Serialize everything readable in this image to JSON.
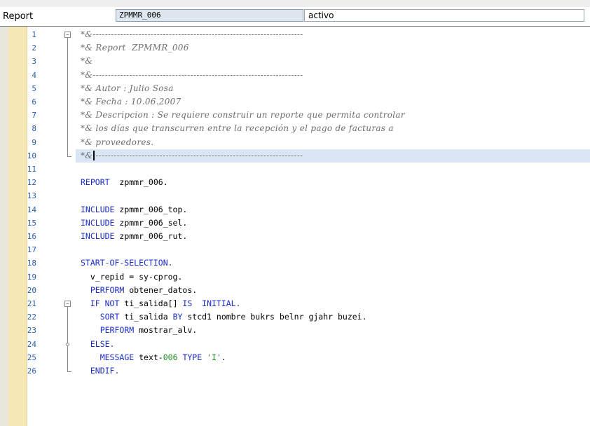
{
  "header": {
    "label": "Report",
    "program_name": "ZPMMR_006",
    "status": "activo"
  },
  "editor": {
    "line_numbers": [
      "1",
      "2",
      "3",
      "4",
      "5",
      "6",
      "7",
      "8",
      "9",
      "10",
      "11",
      "12",
      "13",
      "14",
      "15",
      "16",
      "17",
      "18",
      "19",
      "20",
      "21",
      "22",
      "23",
      "24",
      "25",
      "26"
    ],
    "lines": [
      [
        {
          "t": "*&---------------------------------------------------------------------",
          "c": "cm"
        }
      ],
      [
        {
          "t": "*& Report  ZPMMR_006",
          "c": "cm"
        }
      ],
      [
        {
          "t": "*&",
          "c": "cm"
        }
      ],
      [
        {
          "t": "*&---------------------------------------------------------------------",
          "c": "cm"
        }
      ],
      [
        {
          "t": "*& Autor : Julio Sosa",
          "c": "cm"
        }
      ],
      [
        {
          "t": "*& Fecha : 10.06.2007",
          "c": "cm"
        }
      ],
      [
        {
          "t": "*& Descripcion : Se requiere construir un reporte que permita controlar",
          "c": "cm"
        }
      ],
      [
        {
          "t": "*& los días que transcurren entre la recepción y el pago de facturas a",
          "c": "cm"
        }
      ],
      [
        {
          "t": "*& proveedores.",
          "c": "cm"
        }
      ],
      [
        {
          "t": "*&",
          "c": "cm"
        },
        {
          "t": "",
          "c": "caret"
        },
        {
          "t": "--------------------------------------------------------------------",
          "c": "cm"
        }
      ],
      [],
      [
        {
          "t": "REPORT",
          "c": "kw"
        },
        {
          "t": "  zpmmr_006.",
          "c": ""
        }
      ],
      [],
      [
        {
          "t": "INCLUDE",
          "c": "kw"
        },
        {
          "t": " zpmmr_006_top.",
          "c": ""
        }
      ],
      [
        {
          "t": "INCLUDE",
          "c": "kw"
        },
        {
          "t": " zpmmr_006_sel.",
          "c": ""
        }
      ],
      [
        {
          "t": "INCLUDE",
          "c": "kw"
        },
        {
          "t": " zpmmr_006_rut.",
          "c": ""
        }
      ],
      [],
      [
        {
          "t": "START-OF-SELECTION.",
          "c": "kw"
        }
      ],
      [
        {
          "t": "  v_repid = sy-cprog.",
          "c": ""
        }
      ],
      [
        {
          "t": "  ",
          "c": ""
        },
        {
          "t": "PERFORM",
          "c": "kw"
        },
        {
          "t": " obtener_datos.",
          "c": ""
        }
      ],
      [
        {
          "t": "  ",
          "c": ""
        },
        {
          "t": "IF NOT",
          "c": "kw"
        },
        {
          "t": " ti_salida[] ",
          "c": ""
        },
        {
          "t": "IS",
          "c": "kw"
        },
        {
          "t": "  ",
          "c": ""
        },
        {
          "t": "INITIAL.",
          "c": "kw"
        }
      ],
      [
        {
          "t": "    ",
          "c": ""
        },
        {
          "t": "SORT",
          "c": "kw"
        },
        {
          "t": " ti_salida ",
          "c": ""
        },
        {
          "t": "BY",
          "c": "kw"
        },
        {
          "t": " stcd1 nombre bukrs belnr gjahr buzei.",
          "c": ""
        }
      ],
      [
        {
          "t": "    ",
          "c": ""
        },
        {
          "t": "PERFORM",
          "c": "kw"
        },
        {
          "t": " mostrar_alv.",
          "c": ""
        }
      ],
      [
        {
          "t": "  ",
          "c": ""
        },
        {
          "t": "ELSE.",
          "c": "kw"
        }
      ],
      [
        {
          "t": "    ",
          "c": ""
        },
        {
          "t": "MESSAGE",
          "c": "kw"
        },
        {
          "t": " text-",
          "c": ""
        },
        {
          "t": "006",
          "c": "str"
        },
        {
          "t": " ",
          "c": ""
        },
        {
          "t": "TYPE",
          "c": "kw"
        },
        {
          "t": " ",
          "c": ""
        },
        {
          "t": "'I'",
          "c": "str"
        },
        {
          "t": ".",
          "c": ""
        }
      ],
      [
        {
          "t": "  ",
          "c": ""
        },
        {
          "t": "ENDIF.",
          "c": "kw"
        }
      ]
    ],
    "highlighted_line": 10,
    "colors": {
      "keyword": "#1a2cc8",
      "comment": "#6e6e6e",
      "literal": "#1f8a1f",
      "line_number": "#2a5db0",
      "gutter": "#f6e8b4",
      "current_line": "#dbe6f5"
    }
  }
}
